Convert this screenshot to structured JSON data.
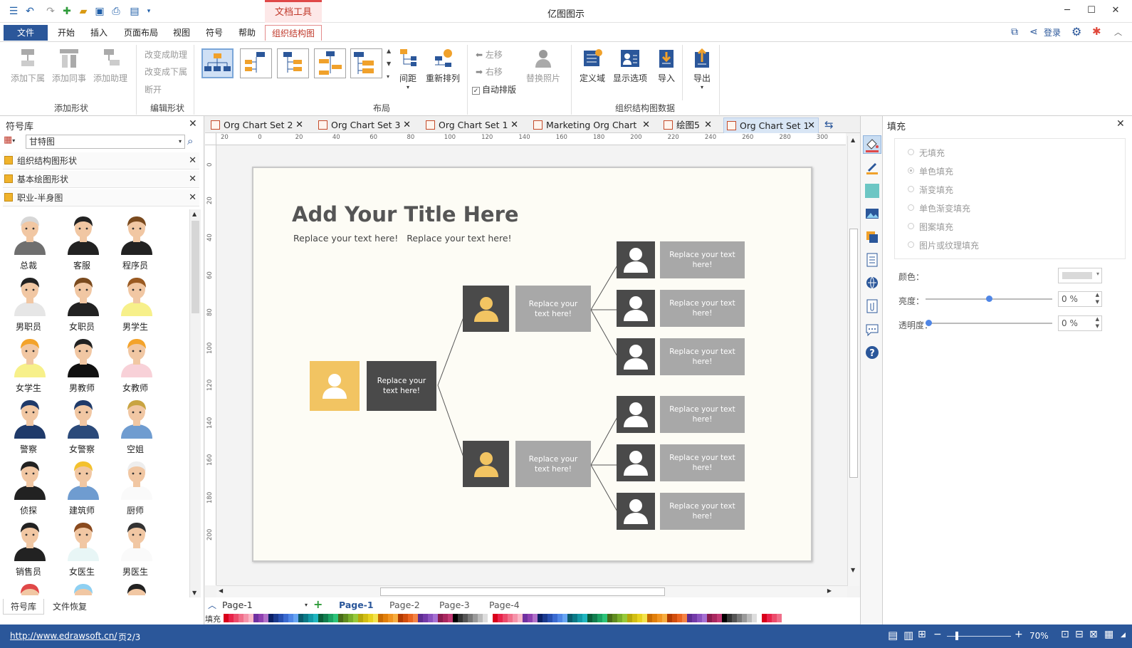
{
  "window": {
    "title": "亿图图示",
    "context_tab": "文档工具"
  },
  "menu": [
    "文件",
    "开始",
    "插入",
    "页面布局",
    "视图",
    "符号",
    "帮助",
    "组织结构图"
  ],
  "login": "登录",
  "ribbon": {
    "add_shape": {
      "buttons": [
        "添加下属",
        "添加同事",
        "添加助理"
      ],
      "label": "添加形状"
    },
    "edit_shape": {
      "items": [
        "改变成助理",
        "改变成下属",
        "断开"
      ],
      "label": "编辑形状"
    },
    "layout": {
      "label": "布局",
      "spacing": "间距",
      "rearrange": "重新排列",
      "move_left": "左移",
      "move_right": "右移",
      "auto_layout": "自动排版",
      "replace_photo": "替换照片"
    },
    "org_data": {
      "label": "组织结构图数据",
      "buttons": [
        "定义域",
        "显示选项",
        "导入",
        "导出"
      ]
    }
  },
  "library": {
    "title": "符号库",
    "search_value": "甘特图",
    "groups": [
      "组织结构图形状",
      "基本绘图形状",
      "职业-半身图"
    ],
    "shapes": [
      "总裁",
      "客服",
      "程序员",
      "男职员",
      "女职员",
      "男学生",
      "女学生",
      "男教师",
      "女教师",
      "警察",
      "女警察",
      "空姐",
      "侦探",
      "建筑师",
      "厨师",
      "销售员",
      "女医生",
      "男医生"
    ],
    "bottom_tabs": [
      "符号库",
      "文件恢复"
    ]
  },
  "doc_tabs": [
    "Org Chart Set 2",
    "Org Chart Set 3",
    "Org Chart Set 1",
    "Marketing Org Chart",
    "绘图5",
    "Org Chart Set 1"
  ],
  "ruler_top": [
    "20",
    "0",
    "20",
    "40",
    "60",
    "80",
    "100",
    "120",
    "140",
    "160",
    "180",
    "200",
    "220",
    "240",
    "260",
    "280",
    "300"
  ],
  "ruler_left": [
    "0",
    "20",
    "40",
    "60",
    "80",
    "100",
    "120",
    "140",
    "160",
    "180",
    "200"
  ],
  "canvas": {
    "title": "Add Your Title Here",
    "subtitle": "Replace your text here!   Replace your text here!",
    "box_text": "Replace your text here!"
  },
  "page_tabs": {
    "current": "Page-1",
    "tabs": [
      "Page-1",
      "Page-2",
      "Page-3",
      "Page-4"
    ],
    "fill_label": "填充"
  },
  "fill_panel": {
    "title": "填充",
    "options": [
      "无填充",
      "单色填充",
      "渐变填充",
      "单色渐变填充",
      "图案填充",
      "图片或纹理填充"
    ],
    "color_label": "颜色：",
    "brightness_label": "亮度：",
    "brightness_value": "0 %",
    "opacity_label": "透明度：",
    "opacity_value": "0 %"
  },
  "status": {
    "url": "http://www.edrawsoft.cn/",
    "page": "页2/3",
    "zoom": "70%"
  },
  "colors": {
    "accent": "#2b579a",
    "dark_box": "#4a4a4a",
    "grey_box": "#a8a8a8",
    "yellow": "#f2c462",
    "page_bg": "#fdfcf5"
  },
  "palette": [
    "#d9001b",
    "#e8234a",
    "#ec4b6b",
    "#f06f8a",
    "#f593a9",
    "#f9b7c7",
    "#7030a0",
    "#8e3fb0",
    "#b06fc8",
    "#0b1f65",
    "#1a3a8e",
    "#274fb0",
    "#3a6ad0",
    "#4f86e6",
    "#66a4f3",
    "#0a5c6d",
    "#0b7a87",
    "#1399a6",
    "#1fb5bf",
    "#0a5e3a",
    "#117e4f",
    "#1ba263",
    "#2bc379",
    "#486b18",
    "#5f8c20",
    "#79ad2b",
    "#96c93a",
    "#b6a70a",
    "#d1be14",
    "#e8d21f",
    "#f3e34c",
    "#c96a00",
    "#e17f0a",
    "#f19420",
    "#f7ad3f",
    "#b33b00",
    "#d14e0d",
    "#ea6420",
    "#f48344",
    "#5e2c91",
    "#733aa8",
    "#8b52bf",
    "#a56fd2",
    "#8a1b4e",
    "#a8275f",
    "#c23974",
    "#000000",
    "#333333",
    "#555555",
    "#777777",
    "#999999",
    "#bbbbbb",
    "#dddddd",
    "#ffffff"
  ]
}
